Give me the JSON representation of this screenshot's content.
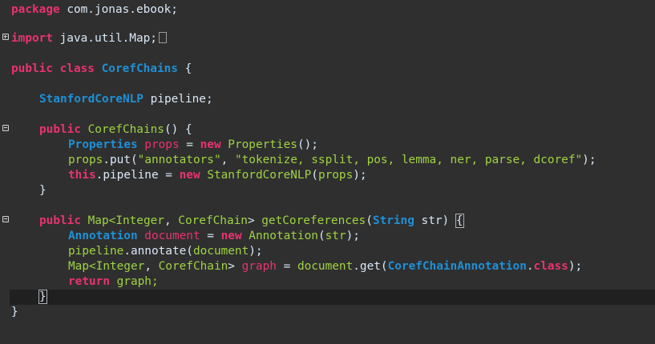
{
  "editor": {
    "lines": {
      "l1": {
        "kw": "package",
        "rest": " com.jonas.ebook;"
      },
      "l2": {
        "kw": "import",
        "rest": " java.util.Map;"
      },
      "l3": {
        "kw1": "public",
        "kw2": " class",
        "name": " CorefChains",
        "rest": " {"
      },
      "l4": {
        "type": "StanfordCoreNLP",
        "rest": " pipeline;"
      },
      "l5": {
        "kw": "public",
        "name": " CorefChains",
        "rest": "() {"
      },
      "l6": {
        "type": "Properties",
        "var": " props",
        "op": " = ",
        "kw": "new",
        "cls": " Properties",
        "rest": "();"
      },
      "l7": {
        "obj": "props",
        "call": ".put(",
        "s1": "\"annotators\"",
        "sep": ", ",
        "s2": "\"tokenize, ssplit, pos, lemma, ner, parse, dcoref\"",
        "rest": ");"
      },
      "l8": {
        "kw": "this",
        "field": ".pipeline",
        "op": " = ",
        "kw2": "new",
        "cls": " StanfordCoreNLP",
        "p1": "(",
        "arg": "props",
        "p2": ");"
      },
      "l9": {
        "rest": "}"
      },
      "l10": {
        "kw": "public",
        "map": " Map<",
        "t1": "Integer",
        "comma": ", ",
        "t2": "CorefChain",
        "gt": "> ",
        "name": "getCoreferences",
        "p1": "(",
        "ptype": "String",
        "pname": " str",
        "p2": ") ",
        "brace": "{"
      },
      "l11": {
        "type": "Annotation",
        "var": " document",
        "op": " = ",
        "kw": "new",
        "cls": " Annotation",
        "p1": "(",
        "arg": "str",
        "p2": ");"
      },
      "l12": {
        "obj": "pipeline",
        "call": ".annotate(",
        "arg": "document",
        "rest": ");"
      },
      "l13": {
        "map": "Map<",
        "t1": "Integer",
        "comma": ", ",
        "t2": "CorefChain",
        "gt": "> ",
        "var": "graph",
        "op": " = ",
        "obj": "document",
        "call": ".get(",
        "ann": "CorefChainAnnotation",
        "dot": ".",
        "kw": "class",
        "rest": ");"
      },
      "l14": {
        "kw": "return",
        "rest": " graph;"
      },
      "l15": {
        "rest": "}"
      },
      "l16": {
        "rest": "}"
      }
    }
  }
}
